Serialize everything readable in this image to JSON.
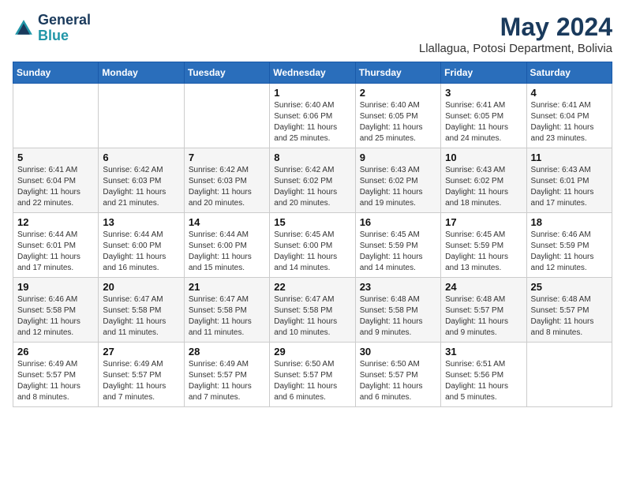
{
  "header": {
    "logo_line1": "General",
    "logo_line2": "Blue",
    "month_year": "May 2024",
    "location": "Llallagua, Potosi Department, Bolivia"
  },
  "weekdays": [
    "Sunday",
    "Monday",
    "Tuesday",
    "Wednesday",
    "Thursday",
    "Friday",
    "Saturday"
  ],
  "weeks": [
    [
      {
        "day": "",
        "info": ""
      },
      {
        "day": "",
        "info": ""
      },
      {
        "day": "",
        "info": ""
      },
      {
        "day": "1",
        "info": "Sunrise: 6:40 AM\nSunset: 6:06 PM\nDaylight: 11 hours\nand 25 minutes."
      },
      {
        "day": "2",
        "info": "Sunrise: 6:40 AM\nSunset: 6:05 PM\nDaylight: 11 hours\nand 25 minutes."
      },
      {
        "day": "3",
        "info": "Sunrise: 6:41 AM\nSunset: 6:05 PM\nDaylight: 11 hours\nand 24 minutes."
      },
      {
        "day": "4",
        "info": "Sunrise: 6:41 AM\nSunset: 6:04 PM\nDaylight: 11 hours\nand 23 minutes."
      }
    ],
    [
      {
        "day": "5",
        "info": "Sunrise: 6:41 AM\nSunset: 6:04 PM\nDaylight: 11 hours\nand 22 minutes."
      },
      {
        "day": "6",
        "info": "Sunrise: 6:42 AM\nSunset: 6:03 PM\nDaylight: 11 hours\nand 21 minutes."
      },
      {
        "day": "7",
        "info": "Sunrise: 6:42 AM\nSunset: 6:03 PM\nDaylight: 11 hours\nand 20 minutes."
      },
      {
        "day": "8",
        "info": "Sunrise: 6:42 AM\nSunset: 6:02 PM\nDaylight: 11 hours\nand 20 minutes."
      },
      {
        "day": "9",
        "info": "Sunrise: 6:43 AM\nSunset: 6:02 PM\nDaylight: 11 hours\nand 19 minutes."
      },
      {
        "day": "10",
        "info": "Sunrise: 6:43 AM\nSunset: 6:02 PM\nDaylight: 11 hours\nand 18 minutes."
      },
      {
        "day": "11",
        "info": "Sunrise: 6:43 AM\nSunset: 6:01 PM\nDaylight: 11 hours\nand 17 minutes."
      }
    ],
    [
      {
        "day": "12",
        "info": "Sunrise: 6:44 AM\nSunset: 6:01 PM\nDaylight: 11 hours\nand 17 minutes."
      },
      {
        "day": "13",
        "info": "Sunrise: 6:44 AM\nSunset: 6:00 PM\nDaylight: 11 hours\nand 16 minutes."
      },
      {
        "day": "14",
        "info": "Sunrise: 6:44 AM\nSunset: 6:00 PM\nDaylight: 11 hours\nand 15 minutes."
      },
      {
        "day": "15",
        "info": "Sunrise: 6:45 AM\nSunset: 6:00 PM\nDaylight: 11 hours\nand 14 minutes."
      },
      {
        "day": "16",
        "info": "Sunrise: 6:45 AM\nSunset: 5:59 PM\nDaylight: 11 hours\nand 14 minutes."
      },
      {
        "day": "17",
        "info": "Sunrise: 6:45 AM\nSunset: 5:59 PM\nDaylight: 11 hours\nand 13 minutes."
      },
      {
        "day": "18",
        "info": "Sunrise: 6:46 AM\nSunset: 5:59 PM\nDaylight: 11 hours\nand 12 minutes."
      }
    ],
    [
      {
        "day": "19",
        "info": "Sunrise: 6:46 AM\nSunset: 5:58 PM\nDaylight: 11 hours\nand 12 minutes."
      },
      {
        "day": "20",
        "info": "Sunrise: 6:47 AM\nSunset: 5:58 PM\nDaylight: 11 hours\nand 11 minutes."
      },
      {
        "day": "21",
        "info": "Sunrise: 6:47 AM\nSunset: 5:58 PM\nDaylight: 11 hours\nand 11 minutes."
      },
      {
        "day": "22",
        "info": "Sunrise: 6:47 AM\nSunset: 5:58 PM\nDaylight: 11 hours\nand 10 minutes."
      },
      {
        "day": "23",
        "info": "Sunrise: 6:48 AM\nSunset: 5:58 PM\nDaylight: 11 hours\nand 9 minutes."
      },
      {
        "day": "24",
        "info": "Sunrise: 6:48 AM\nSunset: 5:57 PM\nDaylight: 11 hours\nand 9 minutes."
      },
      {
        "day": "25",
        "info": "Sunrise: 6:48 AM\nSunset: 5:57 PM\nDaylight: 11 hours\nand 8 minutes."
      }
    ],
    [
      {
        "day": "26",
        "info": "Sunrise: 6:49 AM\nSunset: 5:57 PM\nDaylight: 11 hours\nand 8 minutes."
      },
      {
        "day": "27",
        "info": "Sunrise: 6:49 AM\nSunset: 5:57 PM\nDaylight: 11 hours\nand 7 minutes."
      },
      {
        "day": "28",
        "info": "Sunrise: 6:49 AM\nSunset: 5:57 PM\nDaylight: 11 hours\nand 7 minutes."
      },
      {
        "day": "29",
        "info": "Sunrise: 6:50 AM\nSunset: 5:57 PM\nDaylight: 11 hours\nand 6 minutes."
      },
      {
        "day": "30",
        "info": "Sunrise: 6:50 AM\nSunset: 5:57 PM\nDaylight: 11 hours\nand 6 minutes."
      },
      {
        "day": "31",
        "info": "Sunrise: 6:51 AM\nSunset: 5:56 PM\nDaylight: 11 hours\nand 5 minutes."
      },
      {
        "day": "",
        "info": ""
      }
    ]
  ]
}
